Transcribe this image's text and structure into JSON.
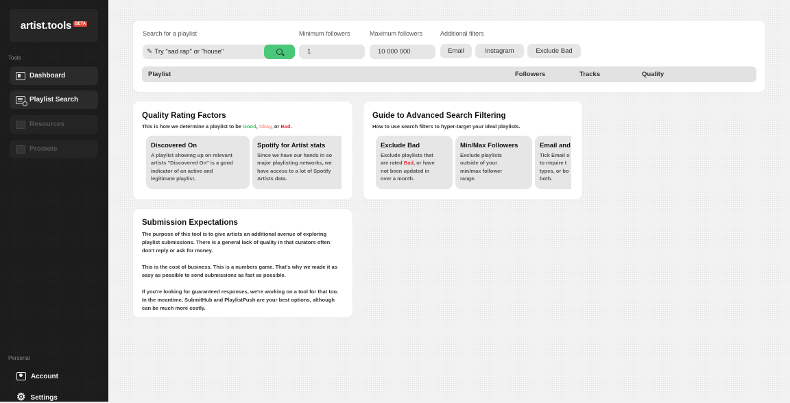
{
  "sidebar": {
    "logo": "artist.tools",
    "beta": "BETA",
    "tools_label": "Tools",
    "items": [
      {
        "label": "Dashboard"
      },
      {
        "label": "Playlist Search"
      },
      {
        "label": "Resources"
      },
      {
        "label": "Promote"
      }
    ],
    "personal_label": "Personal",
    "personal_items": [
      {
        "label": "Account"
      },
      {
        "label": "Settings"
      }
    ]
  },
  "search": {
    "label": "Search for a playlist",
    "placeholder": "Try \"sad rap\" or \"house\"",
    "min_label": "Minimum followers",
    "min_value": "1",
    "max_label": "Maximum followers",
    "max_value": "10 000 000",
    "filters_label": "Additional filters",
    "filters": [
      "Email",
      "Instagram",
      "Exclude Bad"
    ],
    "columns": [
      "Playlist",
      "Followers",
      "Tracks",
      "Quality"
    ]
  },
  "quality": {
    "title": "Quality Rating Factors",
    "subtitle_pre": "This is how we determine a playlist to be ",
    "good": "Good",
    "sep1": ", ",
    "okay": "Okay",
    "sep2": ", or ",
    "bad": "Bad",
    "end": ".",
    "cards": [
      {
        "title": "Discovered On",
        "text": "A playlist showing up on relevant\nartists \"Discovered On\" is a good\nindicator of an active and\nlegitimate playlist."
      },
      {
        "title": "Spotify for Artist stats",
        "text": "Since we have our hands in so\nmajor playlisting networks, we\nhave access to a lot of Spotify\nArtists data."
      }
    ]
  },
  "guide": {
    "title": "Guide to Advanced Search Filtering",
    "subtitle": "How to use search filters to hyper-target your ideal playlists.",
    "cards": [
      {
        "title": "Exclude Bad",
        "text_pre": "Exclude playlists that\nare rated ",
        "bad": "Bad",
        "text_post": ", or have\nnot been updated in\nover a month."
      },
      {
        "title": "Min/Max Followers",
        "text": "Exclude playlists\noutside of your\nmin/max follower\nrange."
      },
      {
        "title": "Email and",
        "text": "Tick Email o\nto require t\ntypes, or bo\nboth."
      }
    ]
  },
  "submission": {
    "title": "Submission Expectations",
    "paragraphs": [
      "The purpose of this tool is to give artists an additional avenue of exploring playlist submissions. There is a general lack of quality in that curators often don't reply or ask for money.",
      "This is the cost of business. This is a numbers game. That's why we made it as easy as possible to send submissions as fast as possible.",
      "If you're looking for guaranteed responses, we're working on a tool for that too. In the meantime, SubmitHub and PlaylistPush are your best options, although can be much more costly."
    ]
  }
}
